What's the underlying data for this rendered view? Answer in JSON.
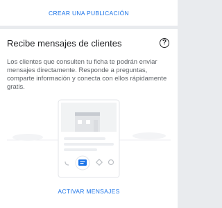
{
  "top_action": {
    "label": "CREAR UNA PUBLICACIÓN"
  },
  "card": {
    "title": "Recibe mensajes de clientes",
    "help_icon": "help-circle-icon",
    "description": "Los clientes que consulten tu ficha te podrán enviar mensajes directamente. Responde a preguntas, comparte información y conecta con ellos rápidamente gratis.",
    "primary_action": {
      "label": "ACTIVAR MENSAJES"
    }
  },
  "illustration": {
    "icons": [
      "phone-icon",
      "message-icon",
      "directions-icon",
      "website-icon"
    ],
    "accent_color": "#1a73e8"
  },
  "colors": {
    "link": "#1a73e8",
    "title": "#202124",
    "body": "#5f6368",
    "background": "#e9ebee"
  }
}
